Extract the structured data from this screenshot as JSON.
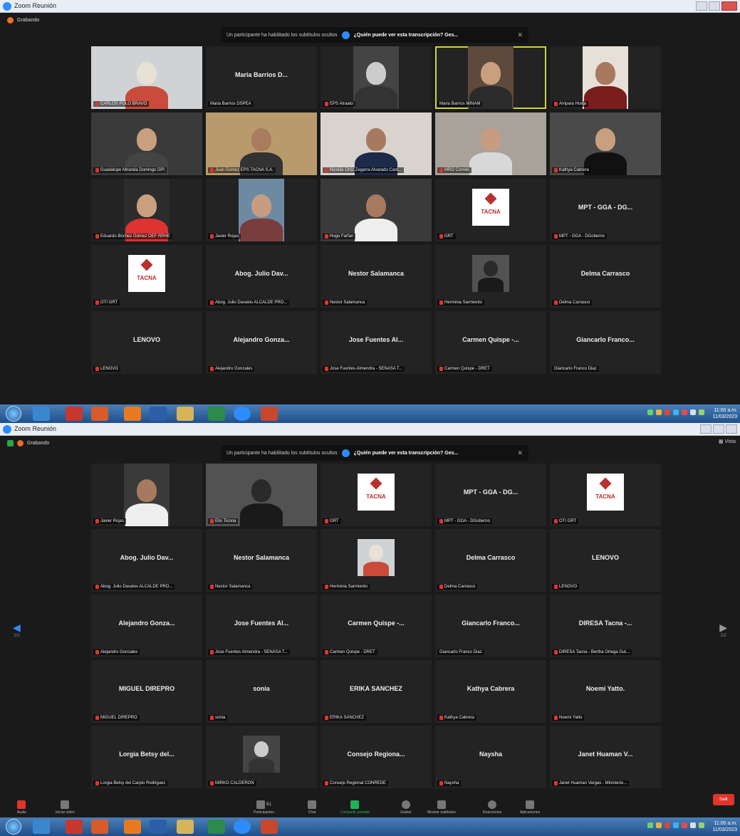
{
  "window": {
    "title": "Zoom Reunión"
  },
  "recording": {
    "label": "Grabando"
  },
  "view": {
    "label": "Vista"
  },
  "caption_banner": {
    "text": "Un participante ha habilitado los subtítulos ocultos",
    "link": "¿Quién puede ver esta transcripción? Ges..."
  },
  "page1_tiles": [
    {
      "kind": "video",
      "name": "",
      "label": "CARLOS POLO BRAVO"
    },
    {
      "kind": "name",
      "name": "Maria Barrios D...",
      "label": "Maria Barrios DSPEA"
    },
    {
      "kind": "video",
      "name": "",
      "label": "EPS Atraato"
    },
    {
      "kind": "video",
      "name": "",
      "label": "Maria Barrios MINAM"
    },
    {
      "kind": "video",
      "name": "",
      "label": "Ampara Hulca"
    },
    {
      "kind": "video",
      "name": "",
      "label": "Guadalupe Miranda Domingo DPI"
    },
    {
      "kind": "video",
      "name": "",
      "label": "Juan Gomez EPS TACNA S.A."
    },
    {
      "kind": "video",
      "name": "",
      "label": "Nicolás Ortiz Zegarra Alvarado Cast..."
    },
    {
      "kind": "video",
      "name": "",
      "label": "MRO Comité"
    },
    {
      "kind": "video",
      "name": "",
      "label": "Kathya Cabrera"
    },
    {
      "kind": "video",
      "name": "",
      "label": "Eduardo Bóchez Gómez OEF RPHE"
    },
    {
      "kind": "video",
      "name": "",
      "label": "Javier Rojas"
    },
    {
      "kind": "video",
      "name": "",
      "label": "Hugo Farfan"
    },
    {
      "kind": "logo",
      "name": "",
      "label": "GRT"
    },
    {
      "kind": "name",
      "name": "MPT - GGA - DG...",
      "label": "MPT - GGA - DGoberno"
    },
    {
      "kind": "logo",
      "name": "",
      "label": "OTI GRT"
    },
    {
      "kind": "name",
      "name": "Abog. Julio Dav...",
      "label": "Abog. Julio Davalos ALCALDE PRO..."
    },
    {
      "kind": "name",
      "name": "Nestor Salamanca",
      "label": "Nestor Salamanca"
    },
    {
      "kind": "photo",
      "name": "",
      "label": "Herminia Sarmiento"
    },
    {
      "kind": "name",
      "name": "Delma Carrasco",
      "label": "Delma Carrasco"
    },
    {
      "kind": "name",
      "name": "LENOVO",
      "label": "LENOVO"
    },
    {
      "kind": "name",
      "name": "Alejandro Gonza...",
      "label": "Alejandro Gonzales"
    },
    {
      "kind": "name",
      "name": "Jose Fuentes Al...",
      "label": "Jose Fuentes Almendra - SENASA T..."
    },
    {
      "kind": "name",
      "name": "Carmen Quispe -...",
      "label": "Carmen Quispe - DRET"
    },
    {
      "kind": "name",
      "name": "Giancarlo Franco...",
      "label": "Giancarlo Franco Diaz"
    }
  ],
  "page2_tiles": [
    {
      "kind": "video",
      "name": "",
      "label": "Javier Rojas"
    },
    {
      "kind": "video",
      "name": "",
      "label": "Elio Ticona"
    },
    {
      "kind": "logo",
      "name": "",
      "label": "GRT"
    },
    {
      "kind": "name",
      "name": "MPT - GGA - DG...",
      "label": "MPT - GGA - DGoberno"
    },
    {
      "kind": "logo",
      "name": "",
      "label": "OTI GRT"
    },
    {
      "kind": "name",
      "name": "Abog. Julio Dav...",
      "label": "Abog. Julio Davalos ALCALDE PRO..."
    },
    {
      "kind": "name",
      "name": "Nestor Salamanca",
      "label": "Nestor Salamanca"
    },
    {
      "kind": "photo",
      "name": "",
      "label": "Herminia Sarmiento"
    },
    {
      "kind": "name",
      "name": "Delma Carrasco",
      "label": "Delma Carrasco"
    },
    {
      "kind": "name",
      "name": "LENOVO",
      "label": "LENOVO"
    },
    {
      "kind": "name",
      "name": "Alejandro Gonza...",
      "label": "Alejandro Gonzales"
    },
    {
      "kind": "name",
      "name": "Jose Fuentes Al...",
      "label": "Jose Fuentes Almendra - SENASA T..."
    },
    {
      "kind": "name",
      "name": "Carmen Quispe -...",
      "label": "Carmen Quispe - DRET"
    },
    {
      "kind": "name",
      "name": "Giancarlo Franco...",
      "label": "Giancarlo Franco Diaz"
    },
    {
      "kind": "name",
      "name": "DIRESA Tacna -...",
      "label": "DIRESA Tacna - Bertha Ortega Gut..."
    },
    {
      "kind": "name",
      "name": "MIGUEL DIREPRO",
      "label": "MIGUEL DIREPRO"
    },
    {
      "kind": "name",
      "name": "sonia",
      "label": "sonia"
    },
    {
      "kind": "name",
      "name": "ERIKA SANCHEZ",
      "label": "ERIKA SANCHEZ"
    },
    {
      "kind": "name",
      "name": "Kathya Cabrera",
      "label": "Kathya Cabrera"
    },
    {
      "kind": "name",
      "name": "Noemi Yatto.",
      "label": "Noemi Yatto"
    },
    {
      "kind": "name",
      "name": "Lorgia Betsy del...",
      "label": "Lorgia Betsy del Carpio Rodriguez"
    },
    {
      "kind": "photo",
      "name": "",
      "label": "MIRKO CALDERON"
    },
    {
      "kind": "name",
      "name": "Consejo Regiona...",
      "label": "Consejo Regional CONREDE"
    },
    {
      "kind": "name",
      "name": "Naysha",
      "label": "Naysha"
    },
    {
      "kind": "name",
      "name": "Janet Huaman V...",
      "label": "Janet Huaman Vargas - Ministerio..."
    }
  ],
  "logo_text": "TACNA",
  "pagination": {
    "left": "2/2",
    "right": "2/2"
  },
  "toolbar": {
    "audio": "Audio",
    "video": "Iniciar video",
    "participants": "Participantes",
    "participants_count": "61",
    "chat": "Chat",
    "share": "Compartir pantalla",
    "record": "Grabar",
    "subtitles": "Mostrar subtítulos",
    "reactions": "Reacciones",
    "apps": "Aplicaciones",
    "leave": "Salir"
  },
  "clock": {
    "time": "11:00 a.m.",
    "date": "11/03/2023"
  },
  "colors": {
    "accent": "#2d8cff",
    "leave": "#e0352b",
    "share": "#1fb25a",
    "active_speaker": "#c8d63a"
  }
}
